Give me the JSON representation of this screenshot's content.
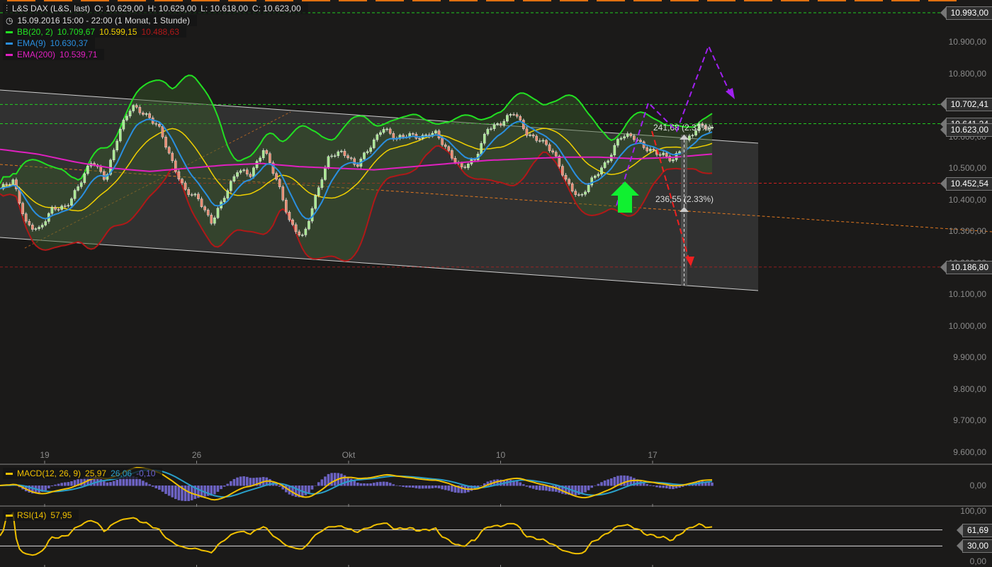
{
  "header": {
    "instrument": "L&S DAX (L&S, last)",
    "open": "O: 10.629,00",
    "high": "H: 10.629,00",
    "low": "L: 10.618,00",
    "close": "C: 10.623,00",
    "period": "15.09.2016 15:00 - 22:00 (1 Monat, 1 Stunde)"
  },
  "legend": {
    "bb": {
      "label": "BB(20, 2)",
      "upper": "10.709,67",
      "middle": "10.599,15",
      "lower": "10.488,63"
    },
    "ema9": {
      "label": "EMA(9)",
      "value": "10.630,37"
    },
    "ema200": {
      "label": "EMA(200)",
      "value": "10.539,71"
    },
    "macd": {
      "label": "MACD(12, 26, 9)",
      "macd": "25,97",
      "signal": "26,06",
      "hist": "-0,10"
    },
    "rsi": {
      "label": "RSI(14)",
      "value": "57,95"
    }
  },
  "colors": {
    "bb_upper": "#22e022",
    "bb_mid": "#f0d000",
    "bb_lower": "#b01818",
    "ema9": "#2a8fe0",
    "ema200": "#e020c0",
    "macd": "#f0c000",
    "signal": "#2a9fc8",
    "hist": "#7a70e0",
    "rsi": "#f0c000"
  },
  "annotations": {
    "upper_measure": "241,68 (2.33%)",
    "lower_measure": "236,55 (2.33%)"
  },
  "chart_data": {
    "type": "candlestick",
    "title": "L&S DAX (L&S, last)",
    "ylim": [
      9600,
      10993
    ],
    "y_ticks": [
      "10.900,00",
      "10.800,00",
      "10.600,00",
      "10.500,00",
      "10.400,00",
      "10.300,00",
      "10.200,00",
      "10.100,00",
      "10.000,00",
      "9.900,00",
      "9.800,00",
      "9.700,00",
      "9.600,00"
    ],
    "y_tick_values": [
      10900,
      10800,
      10600,
      10500,
      10400,
      10300,
      10200,
      10100,
      10000,
      9900,
      9800,
      9700,
      9600
    ],
    "x_ticks": [
      "19",
      "26",
      "Okt",
      "10",
      "17"
    ],
    "close_keypoints": [
      10435,
      10457,
      10326,
      10305,
      10370,
      10381,
      10446,
      10523,
      10468,
      10610,
      10697,
      10675,
      10632,
      10523,
      10435,
      10403,
      10326,
      10414,
      10490,
      10479,
      10566,
      10457,
      10326,
      10283,
      10414,
      10544,
      10555,
      10501,
      10566,
      10632,
      10588,
      10610,
      10599,
      10610,
      10555,
      10501,
      10523,
      10632,
      10643,
      10675,
      10610,
      10588,
      10544,
      10457,
      10403,
      10468,
      10523,
      10599,
      10599,
      10566,
      10544,
      10523,
      10588,
      10632,
      10623
    ],
    "ema200_keypoints": [
      10560,
      10545,
      10520,
      10500,
      10490,
      10500,
      10510,
      10515,
      10505,
      10500,
      10495,
      10505,
      10515,
      10525,
      10530,
      10535,
      10535,
      10530,
      10535,
      10545
    ],
    "levels": [
      {
        "label": "10.993,00",
        "value": 10993,
        "color": "#22e022"
      },
      {
        "label": "10.702,41",
        "value": 10702.41,
        "color": "#22e022"
      },
      {
        "label": "10.641,24",
        "value": 10641.24,
        "color": "#22e022"
      },
      {
        "label": "10.623,00",
        "value": 10623,
        "color": "#ffffff"
      },
      {
        "label": "10.452,54",
        "value": 10452.54,
        "color": "#e02020"
      },
      {
        "label": "10.186,80",
        "value": 10186.8,
        "color": "#e02020"
      }
    ],
    "macd_ticks": [
      "0,00"
    ],
    "rsi_ticks": [
      "100,00",
      "0,00"
    ],
    "rsi_levels": [
      {
        "label": "61,69",
        "value": 61.69
      },
      {
        "label": "30,00",
        "value": 30
      }
    ]
  }
}
